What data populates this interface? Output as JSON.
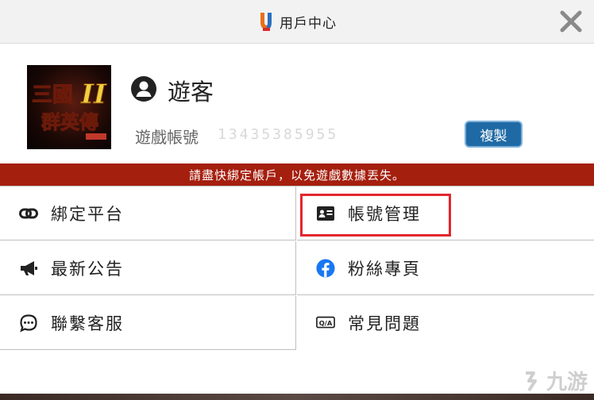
{
  "header": {
    "title": "用戶中心"
  },
  "profile": {
    "thumbnail_alt_text": "三國群英傳",
    "username": "遊客",
    "account_label": "遊戲帳號",
    "account_value": "13435385955",
    "copy_label": "複製"
  },
  "warning": {
    "text": "請盡快綁定帳戶，以免遊戲數據丟失。"
  },
  "menu": {
    "bind_platform": {
      "label": "綁定平台",
      "icon": "link-icon"
    },
    "account_manage": {
      "label": "帳號管理",
      "icon": "id-card-icon"
    },
    "announcements": {
      "label": "最新公告",
      "icon": "megaphone-icon"
    },
    "fan_page": {
      "label": "粉絲專頁",
      "icon": "facebook-icon"
    },
    "customer_service": {
      "label": "聯繫客服",
      "icon": "chat-icon"
    },
    "faq": {
      "label": "常見問題",
      "icon": "qa-icon"
    }
  },
  "watermark": {
    "text": "九游"
  },
  "colors": {
    "warning_bg": "#a51f0e",
    "copy_button": "#1f6aa5",
    "highlight": "#e3262e",
    "facebook": "#1877f2"
  }
}
